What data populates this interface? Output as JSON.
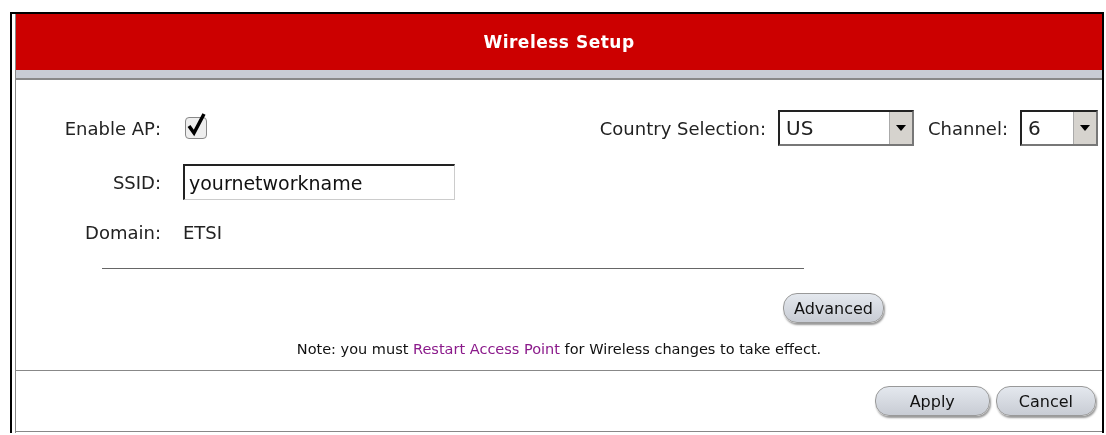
{
  "header": {
    "title": "Wireless Setup"
  },
  "enable_ap": {
    "label": "Enable AP:",
    "checked": true
  },
  "country": {
    "label": "Country Selection:",
    "value": "US"
  },
  "channel": {
    "label": "Channel:",
    "value": "6"
  },
  "ssid": {
    "label": "SSID:",
    "value": "yournetworkname"
  },
  "domain": {
    "label": "Domain:",
    "value": "ETSI"
  },
  "advanced_button": "Advanced",
  "note": {
    "before": "Note: you must ",
    "link": "Restart Access Point",
    "after": " for Wireless changes to take effect."
  },
  "buttons": [
    "Apply",
    "Cancel"
  ]
}
